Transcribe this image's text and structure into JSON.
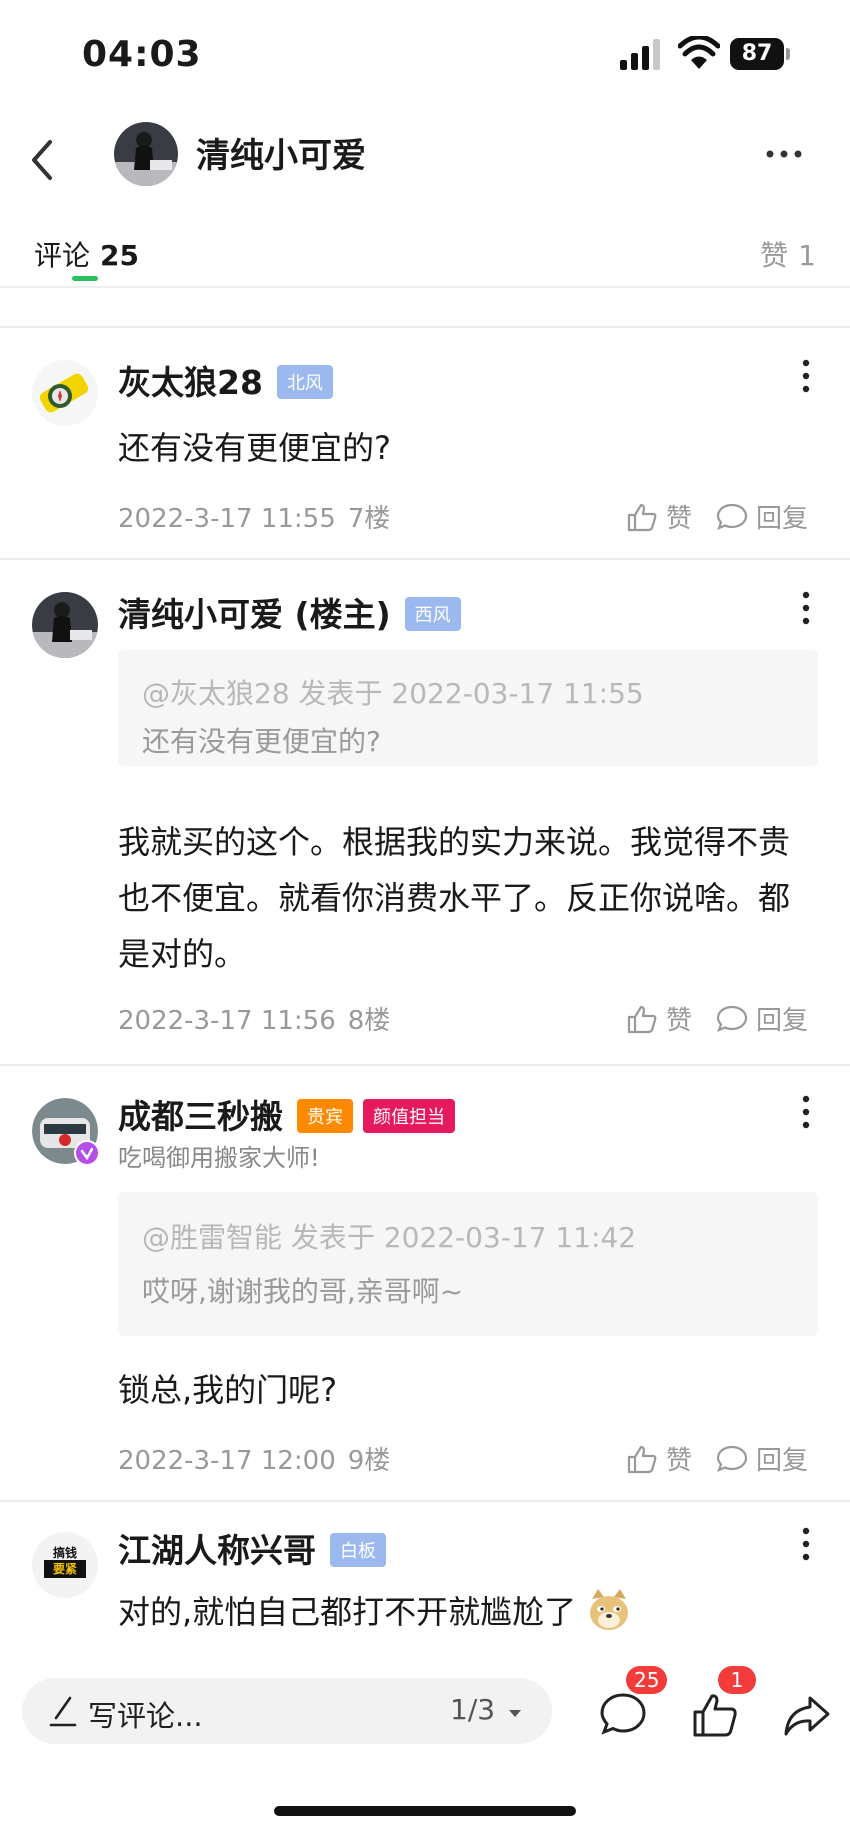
{
  "status_bar": {
    "time": "04:03",
    "battery": "87"
  },
  "nav": {
    "title": "清纯小可爱",
    "back_icon": "chevron-left-icon",
    "more_icon": "more-horizontal-icon"
  },
  "tabs": {
    "comments_label": "评论",
    "comments_count": "25",
    "likes_label": "赞",
    "likes_count": "1"
  },
  "comments": [
    {
      "name": "灰太狼28",
      "badges": [
        "北风"
      ],
      "text": "还有没有更便宜的?",
      "time": "2022-3-17 11:55",
      "floor": "7楼",
      "like": "赞",
      "reply": "回复"
    },
    {
      "name": "清纯小可爱 (楼主)",
      "badges": [
        "西风"
      ],
      "quote_head": "@灰太狼28 发表于 2022-03-17 11:55",
      "quote_text": "还有没有更便宜的?",
      "text": "我就买的这个。根据我的实力来说。我觉得不贵也不便宜。就看你消费水平了。反正你说啥。都是对的。",
      "time": "2022-3-17 11:56",
      "floor": "8楼",
      "like": "赞",
      "reply": "回复"
    },
    {
      "name": "成都三秒搬",
      "badges": [
        "贵宾",
        "颜值担当"
      ],
      "signature": "吃喝御用搬家大师!",
      "quote_head": "@胜雷智能 发表于 2022-03-17 11:42",
      "quote_text": "哎呀,谢谢我的哥,亲哥啊~",
      "text": "锁总,我的门呢?",
      "time": "2022-3-17 12:00",
      "floor": "9楼",
      "like": "赞",
      "reply": "回复"
    },
    {
      "name": "江湖人称兴哥",
      "badges": [
        "白板"
      ],
      "avatar_text": [
        "搞钱",
        "要紧"
      ],
      "text": "对的,就怕自己都打不开就尴尬了",
      "emoji": "doge-emoji"
    }
  ],
  "bottom_bar": {
    "compose_placeholder": "写评论...",
    "page": "1/3",
    "comment_count": "25",
    "like_count": "1",
    "icons": [
      "comment-icon",
      "thumbs-up-icon",
      "share-icon"
    ]
  },
  "colors": {
    "accent_green": "#2dbe60",
    "badge_blue": "#9bb8ef",
    "badge_orange": "#ff8a00",
    "badge_pink": "#e5195d",
    "notif_red": "#f23c3c"
  }
}
